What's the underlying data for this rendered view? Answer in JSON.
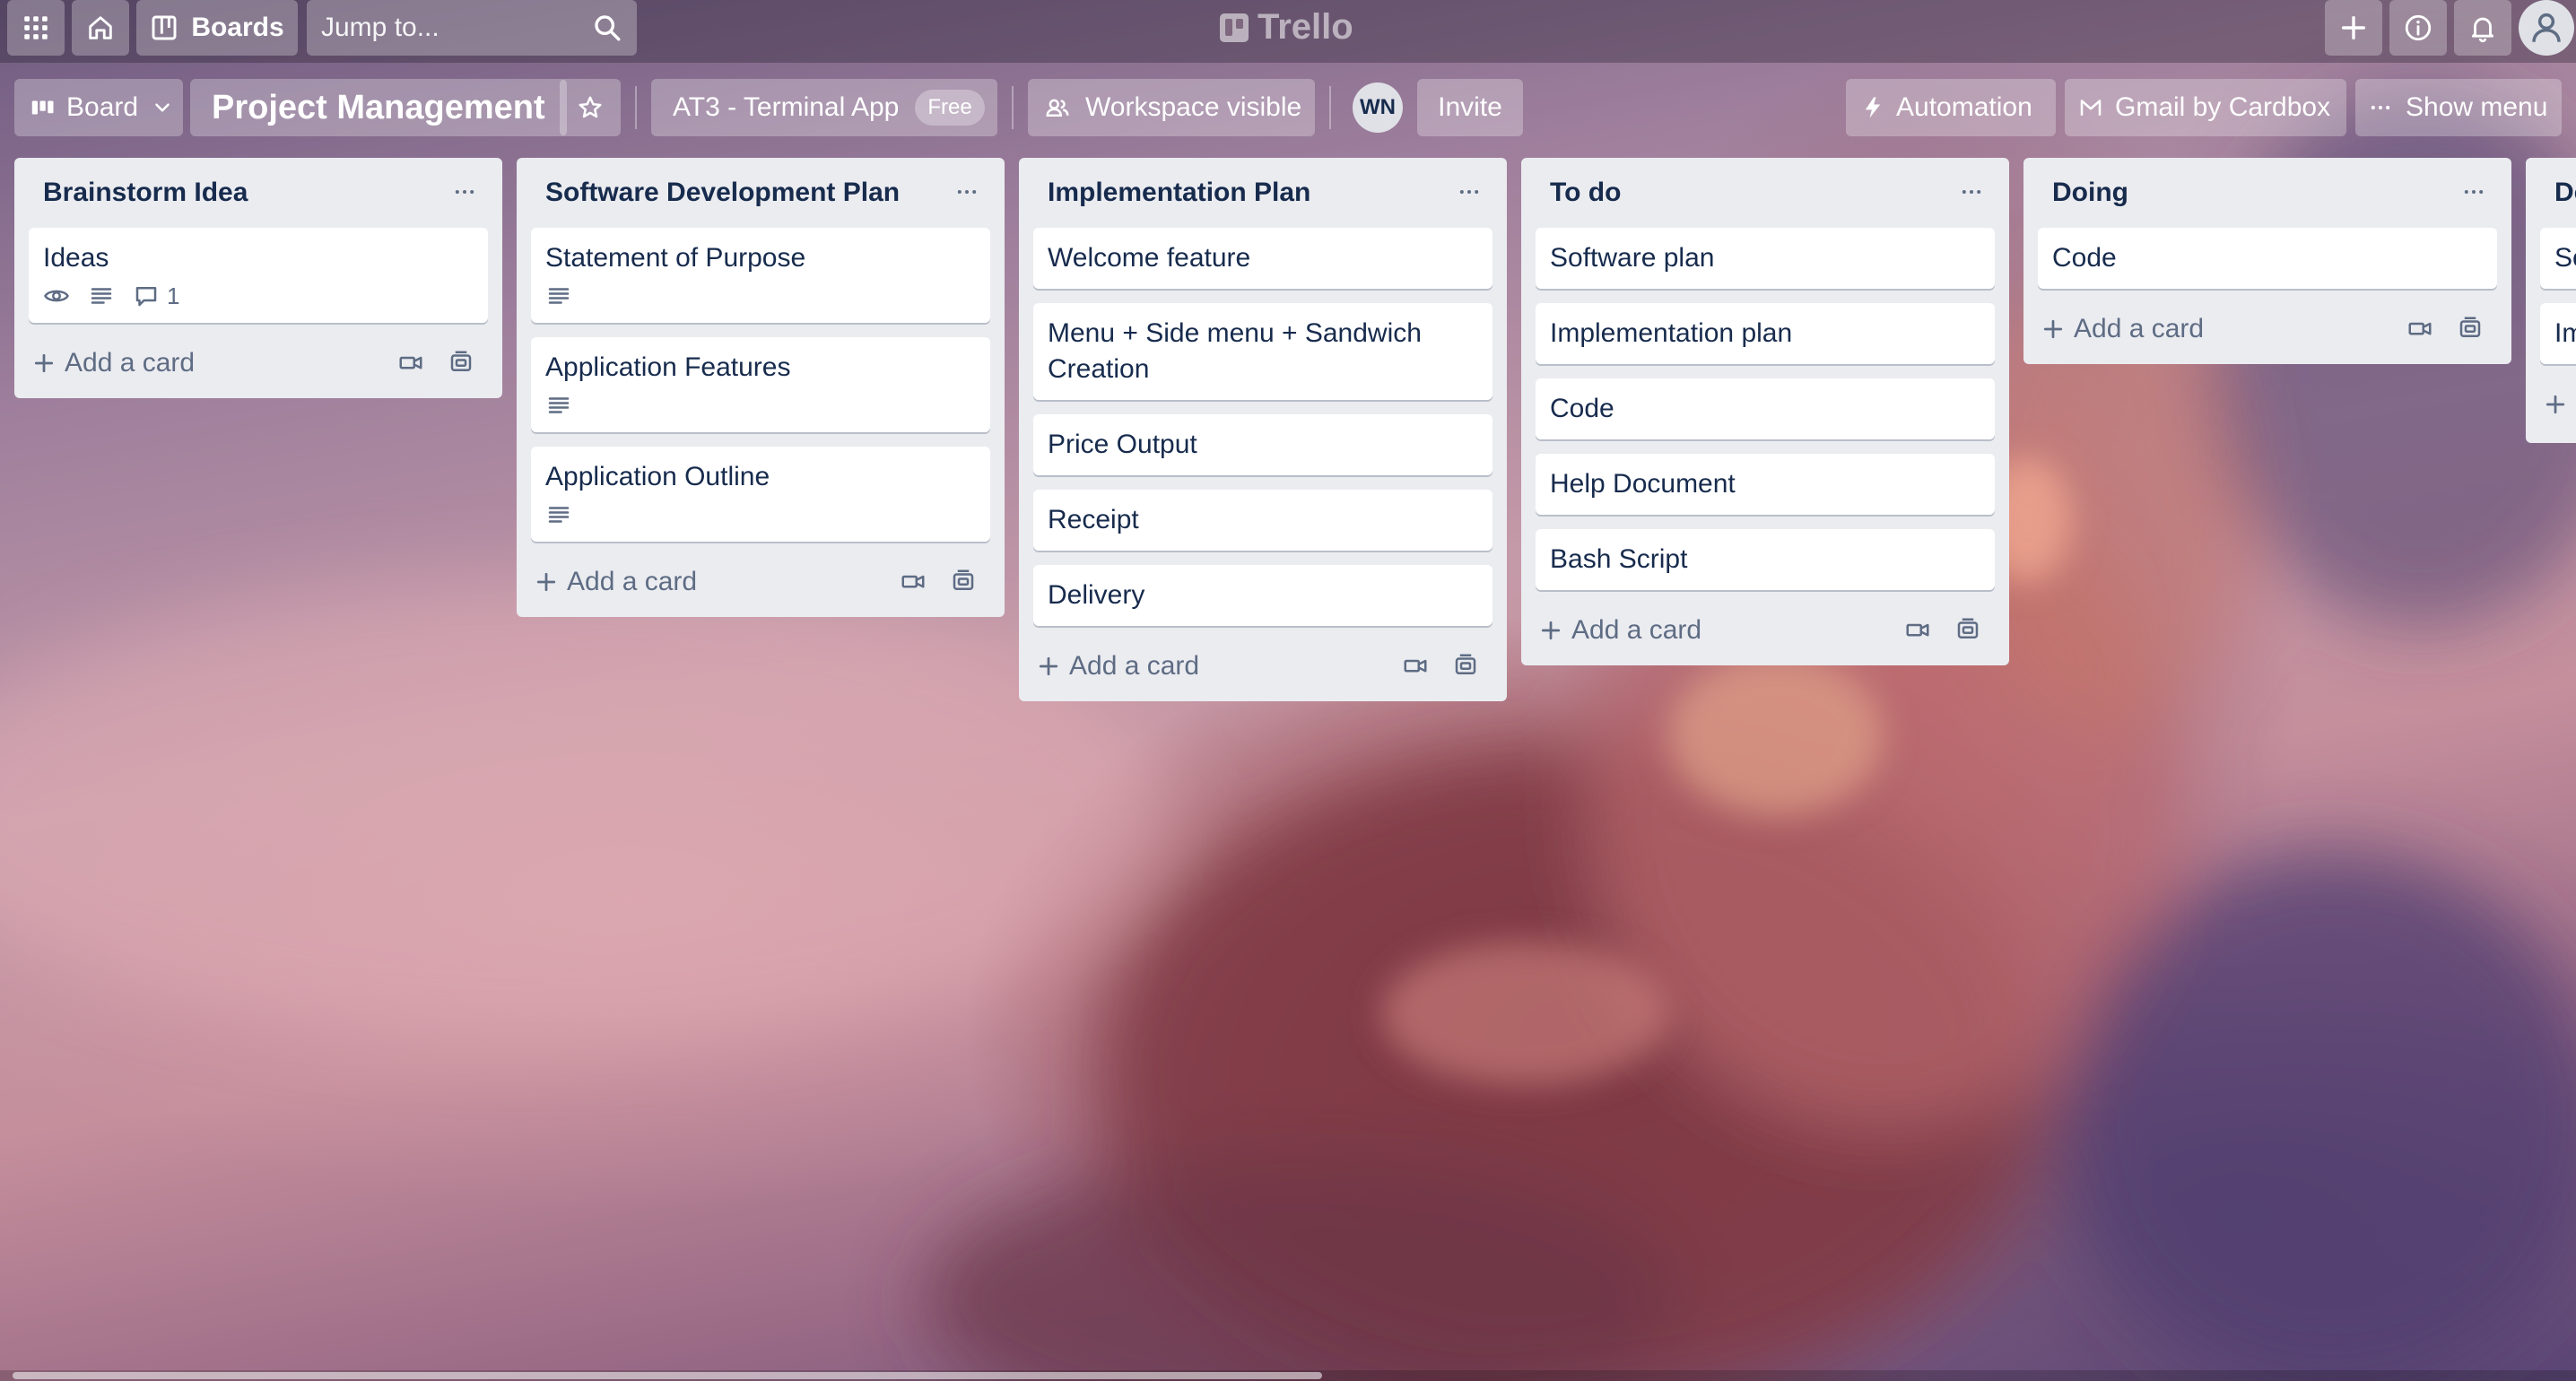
{
  "topbar": {
    "boards_label": "Boards",
    "search_placeholder": "Jump to...",
    "logo": "Trello"
  },
  "board_header": {
    "view_label": "Board",
    "title": "Project Management",
    "workspace": "AT3 - Terminal App",
    "plan_badge": "Free",
    "visibility": "Workspace visible",
    "member_initials": "WN",
    "invite_label": "Invite",
    "automation_label": "Automation",
    "power_up_label": "Gmail by Cardbox",
    "show_menu_label": "Show menu"
  },
  "add_card_label": "Add a card",
  "lists": [
    {
      "title": "Brainstorm Idea",
      "cards": [
        {
          "title": "Ideas",
          "watch": true,
          "description": true,
          "comments": "1"
        }
      ]
    },
    {
      "title": "Software Development Plan",
      "cards": [
        {
          "title": "Statement of Purpose",
          "description": true
        },
        {
          "title": "Application Features",
          "description": true
        },
        {
          "title": "Application Outline",
          "description": true
        }
      ]
    },
    {
      "title": "Implementation Plan",
      "cards": [
        {
          "title": "Welcome feature"
        },
        {
          "title": "Menu + Side menu + Sandwich Creation"
        },
        {
          "title": "Price Output"
        },
        {
          "title": "Receipt"
        },
        {
          "title": "Delivery"
        }
      ]
    },
    {
      "title": "To do",
      "cards": [
        {
          "title": "Software plan"
        },
        {
          "title": "Implementation plan"
        },
        {
          "title": "Code"
        },
        {
          "title": "Help Document"
        },
        {
          "title": "Bash Script"
        }
      ]
    },
    {
      "title": "Doing",
      "cards": [
        {
          "title": "Code"
        }
      ]
    },
    {
      "title": "Do",
      "cards": [
        {
          "title": "So"
        },
        {
          "title": "Im"
        }
      ]
    }
  ],
  "colors": {
    "list_bg": "#ebecf0",
    "card_bg": "#ffffff",
    "text": "#172b4d",
    "muted": "#5e6c84"
  }
}
